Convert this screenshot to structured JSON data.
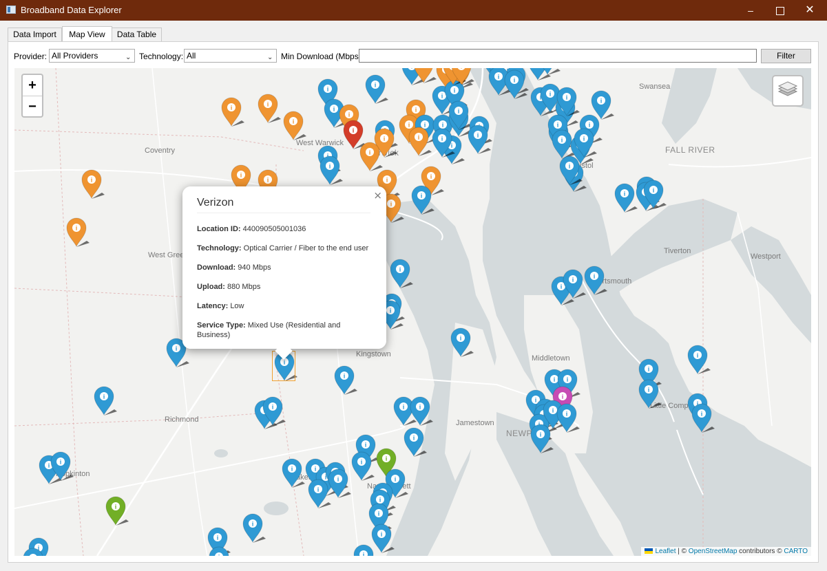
{
  "window": {
    "title": "Broadband Data Explorer",
    "minimize": "–",
    "close": "✕"
  },
  "tabs": [
    {
      "label": "Data Import"
    },
    {
      "label": "Map View"
    },
    {
      "label": "Data Table"
    }
  ],
  "active_tab": "Map View",
  "filters": {
    "provider_label": "Provider:",
    "provider_value": "All Providers",
    "technology_label": "Technology:",
    "technology_value": "All",
    "min_download_label": "Min Download (Mbps):",
    "min_download_value": "",
    "filter_button": "Filter"
  },
  "map": {
    "zoom_in": "+",
    "zoom_out": "−",
    "places": [
      "Swansea",
      "Coventry",
      "West Warwick",
      "Warwick",
      "FALL RIVER",
      "Tiverton",
      "Westport",
      "West Greenwich",
      "Kingstown",
      "Middletown",
      "Richmond",
      "Jamestown",
      "NEWPORT",
      "Little Compton",
      "Narragansett",
      "Bristol",
      "Portsmouth",
      "Hopkinton",
      "Wakefield"
    ],
    "attribution": {
      "leaflet": "Leaflet",
      "sep": " | © ",
      "osm": "OpenStreetMap",
      "contributors": " contributors © ",
      "carto": "CARTO"
    },
    "marker_colors": {
      "blue": "#2f9ad4",
      "orange": "#ef9431",
      "red": "#d33d29",
      "green": "#72af26",
      "purple": "#c74bb4"
    },
    "marker_glyph": "i"
  },
  "popup": {
    "title": "Verizon",
    "close": "×",
    "fields": [
      {
        "label": "Location ID:",
        "value": "440090505001036"
      },
      {
        "label": "Technology:",
        "value": "Optical Carrier / Fiber to the end user"
      },
      {
        "label": "Download:",
        "value": "940 Mbps"
      },
      {
        "label": "Upload:",
        "value": "880 Mbps"
      },
      {
        "label": "Latency:",
        "value": "Low"
      },
      {
        "label": "Service Type:",
        "value": "Mixed Use (Residential and Business)"
      }
    ]
  }
}
